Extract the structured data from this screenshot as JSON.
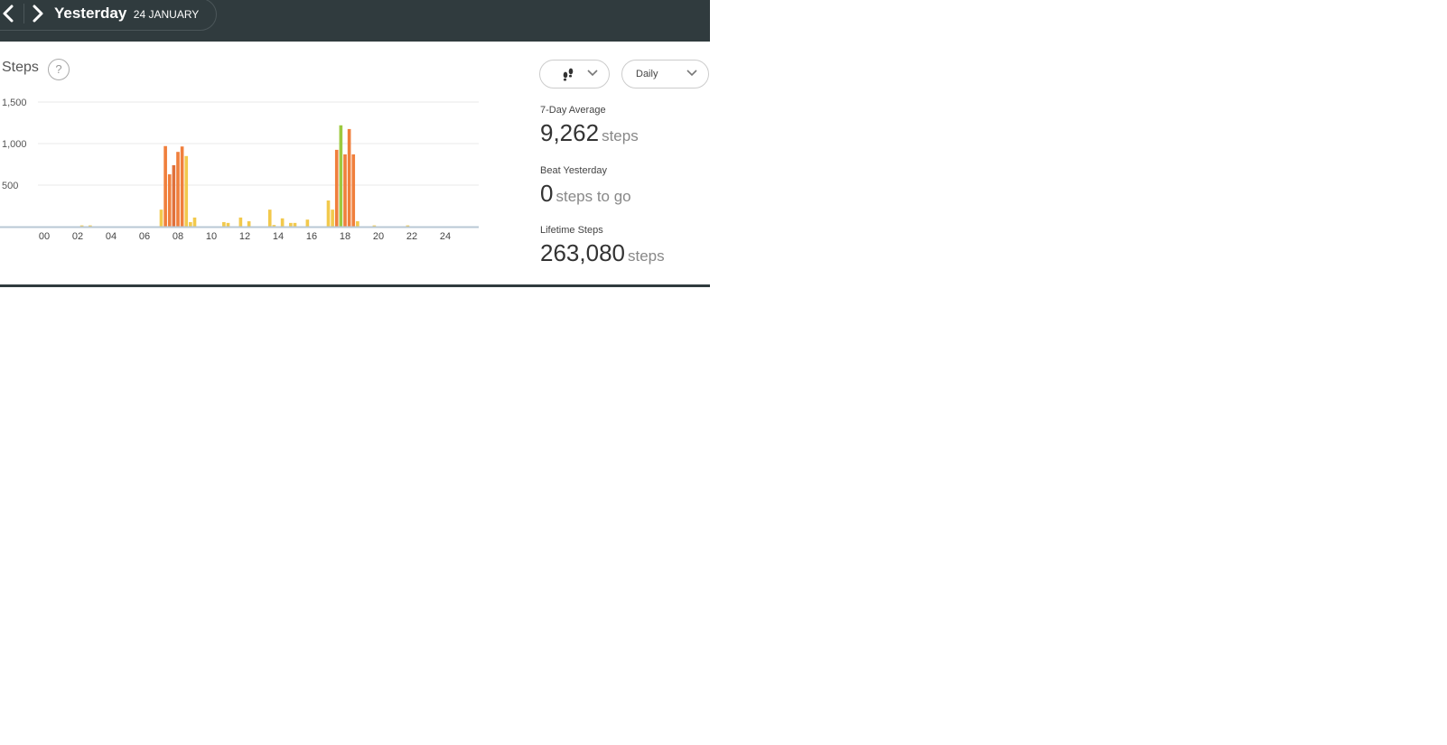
{
  "header": {
    "prev_label": "Previous day",
    "next_label": "Next day",
    "day": "Yesterday",
    "date": "24 JANUARY"
  },
  "controls": {
    "activity_icon": "footsteps-icon",
    "period": "Daily"
  },
  "stats": [
    {
      "label": "7-Day Average",
      "value": "9,262",
      "unit": "steps"
    },
    {
      "label": "Beat Yesterday",
      "value": "0",
      "unit": "steps to go"
    },
    {
      "label": "Lifetime Steps",
      "value": "263,080",
      "unit": "steps"
    }
  ],
  "colors": {
    "low": "#f2c94c",
    "mid": "#f07f3c",
    "mid_dark": "#e0703a",
    "high": "#9cc93f",
    "header_bg": "#303b3e",
    "grid": "#e8e8e8",
    "axis": "#b8c8d4"
  },
  "chart_data": {
    "type": "bar",
    "title": "Steps",
    "help_label": "?",
    "xlabel": "",
    "ylabel": "",
    "ylim": [
      0,
      1500
    ],
    "yticks": [
      500,
      1000,
      1500
    ],
    "ytick_labels": [
      "500",
      "1,000",
      "1,500"
    ],
    "xticks_hours": [
      0,
      2,
      4,
      6,
      8,
      10,
      12,
      14,
      16,
      18,
      20,
      22,
      24
    ],
    "xtick_labels": [
      "00",
      "02",
      "04",
      "06",
      "08",
      "10",
      "12",
      "14",
      "16",
      "18",
      "20",
      "22",
      "24"
    ],
    "interval_minutes": 15,
    "grid": true,
    "bars": [
      {
        "time": "02:15",
        "value": 15,
        "level": "low"
      },
      {
        "time": "02:45",
        "value": 15,
        "level": "low"
      },
      {
        "time": "07:00",
        "value": 205,
        "level": "low"
      },
      {
        "time": "07:15",
        "value": 970,
        "level": "mid"
      },
      {
        "time": "07:30",
        "value": 630,
        "level": "mid"
      },
      {
        "time": "07:45",
        "value": 740,
        "level": "mid_dark"
      },
      {
        "time": "08:00",
        "value": 900,
        "level": "mid"
      },
      {
        "time": "08:15",
        "value": 965,
        "level": "mid"
      },
      {
        "time": "08:30",
        "value": 850,
        "level": "low"
      },
      {
        "time": "08:45",
        "value": 55,
        "level": "low"
      },
      {
        "time": "09:00",
        "value": 110,
        "level": "low"
      },
      {
        "time": "10:45",
        "value": 55,
        "level": "low"
      },
      {
        "time": "11:00",
        "value": 45,
        "level": "low"
      },
      {
        "time": "11:45",
        "value": 110,
        "level": "low"
      },
      {
        "time": "12:15",
        "value": 65,
        "level": "low"
      },
      {
        "time": "13:30",
        "value": 205,
        "level": "low"
      },
      {
        "time": "13:45",
        "value": 20,
        "level": "low"
      },
      {
        "time": "14:15",
        "value": 100,
        "level": "low"
      },
      {
        "time": "14:45",
        "value": 45,
        "level": "low"
      },
      {
        "time": "15:00",
        "value": 45,
        "level": "low"
      },
      {
        "time": "15:45",
        "value": 85,
        "level": "low"
      },
      {
        "time": "17:00",
        "value": 315,
        "level": "low"
      },
      {
        "time": "17:15",
        "value": 205,
        "level": "low"
      },
      {
        "time": "17:30",
        "value": 925,
        "level": "mid"
      },
      {
        "time": "17:45",
        "value": 1220,
        "level": "high"
      },
      {
        "time": "18:00",
        "value": 870,
        "level": "mid"
      },
      {
        "time": "18:15",
        "value": 1175,
        "level": "mid"
      },
      {
        "time": "18:30",
        "value": 870,
        "level": "mid"
      },
      {
        "time": "18:45",
        "value": 65,
        "level": "low"
      },
      {
        "time": "19:45",
        "value": 15,
        "level": "low"
      },
      {
        "time": "21:45",
        "value": 15,
        "level": "low"
      }
    ]
  }
}
